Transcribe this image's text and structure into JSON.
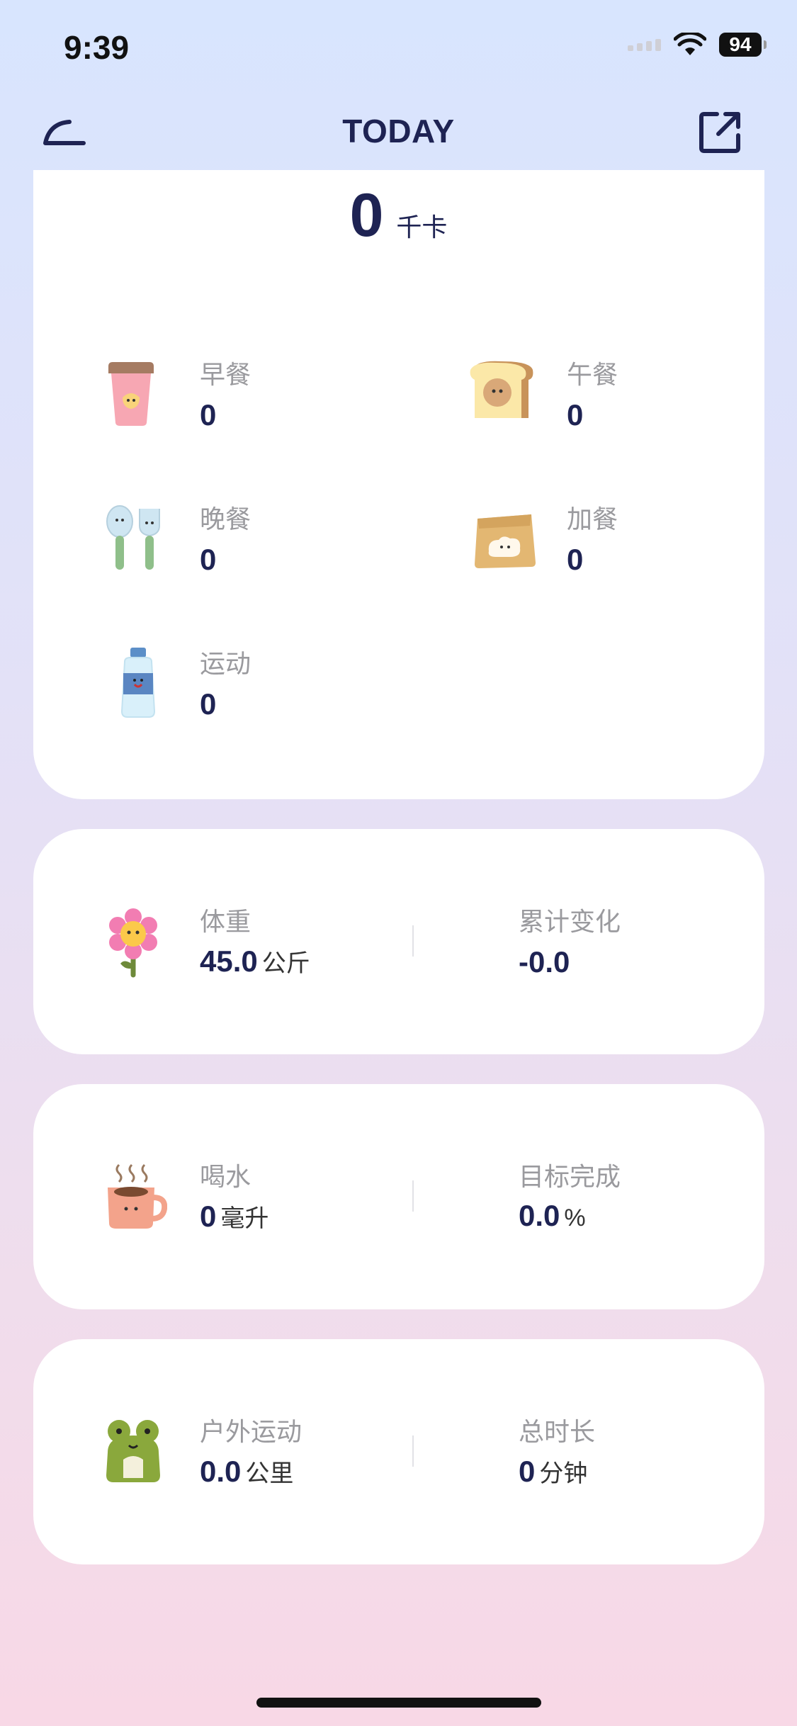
{
  "status_bar": {
    "time": "9:39",
    "battery": "94"
  },
  "nav": {
    "title": "TODAY"
  },
  "total": {
    "value": "0",
    "unit": "千卡"
  },
  "meals": [
    {
      "label": "早餐",
      "value": "0",
      "icon": "coffee-cup-icon"
    },
    {
      "label": "午餐",
      "value": "0",
      "icon": "toast-icon"
    },
    {
      "label": "晚餐",
      "value": "0",
      "icon": "spoon-fork-icon"
    },
    {
      "label": "加餐",
      "value": "0",
      "icon": "paper-bag-icon"
    },
    {
      "label": "运动",
      "value": "0",
      "icon": "water-bottle-icon"
    }
  ],
  "weight": {
    "label": "体重",
    "value": "45.0",
    "unit": "公斤",
    "change_label": "累计变化",
    "change_value": "-0.0"
  },
  "water": {
    "label": "喝水",
    "value": "0",
    "unit": "毫升",
    "goal_label": "目标完成",
    "goal_value": "0.0",
    "goal_unit": "%"
  },
  "outdoor": {
    "label": "户外运动",
    "value": "0.0",
    "unit": "公里",
    "duration_label": "总时长",
    "duration_value": "0",
    "duration_unit": "分钟"
  }
}
